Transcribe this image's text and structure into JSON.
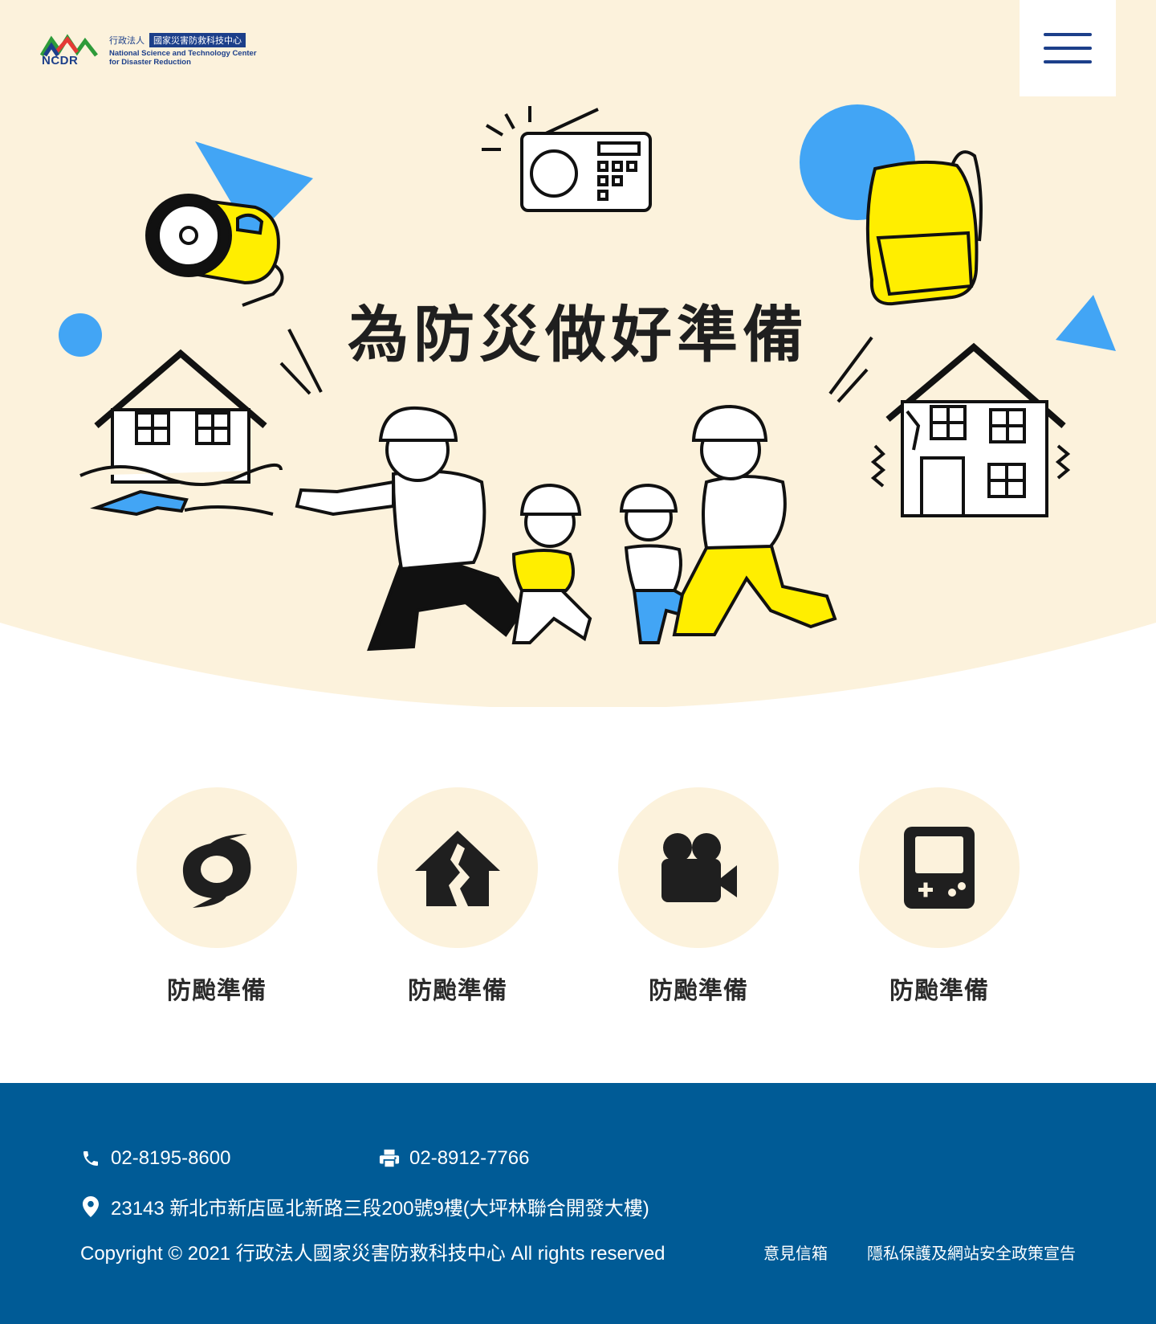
{
  "header": {
    "logo": {
      "mark": "NCDR",
      "prefix": "行政法人",
      "org_zh": "國家災害防救科技中心",
      "org_en_line1": "National Science and Technology Center",
      "org_en_line2": "for Disaster Reduction"
    },
    "menu_icon": "hamburger-menu-icon"
  },
  "hero": {
    "title": "為防災做好準備"
  },
  "categories": [
    {
      "icon": "typhoon-icon",
      "label": "防颱準備"
    },
    {
      "icon": "earthquake-house-icon",
      "label": "防颱準備"
    },
    {
      "icon": "video-camera-icon",
      "label": "防颱準備"
    },
    {
      "icon": "game-console-icon",
      "label": "防颱準備"
    }
  ],
  "footer": {
    "phone": "02-8195-8600",
    "fax": "02-8912-7766",
    "address": "23143 新北市新店區北新路三段200號9樓(大坪林聯合開發大樓)",
    "copyright": "Copyright © 2021 行政法人國家災害防救科技中心 All rights reserved",
    "links": [
      "意見信箱",
      "隱私保護及網站安全政策宣告"
    ]
  },
  "colors": {
    "hero_bg": "#fcf2dc",
    "brand_blue": "#1c3f8a",
    "footer_bg": "#005b96",
    "accent_blue": "#42a5f5",
    "accent_yellow": "#ffee00"
  }
}
